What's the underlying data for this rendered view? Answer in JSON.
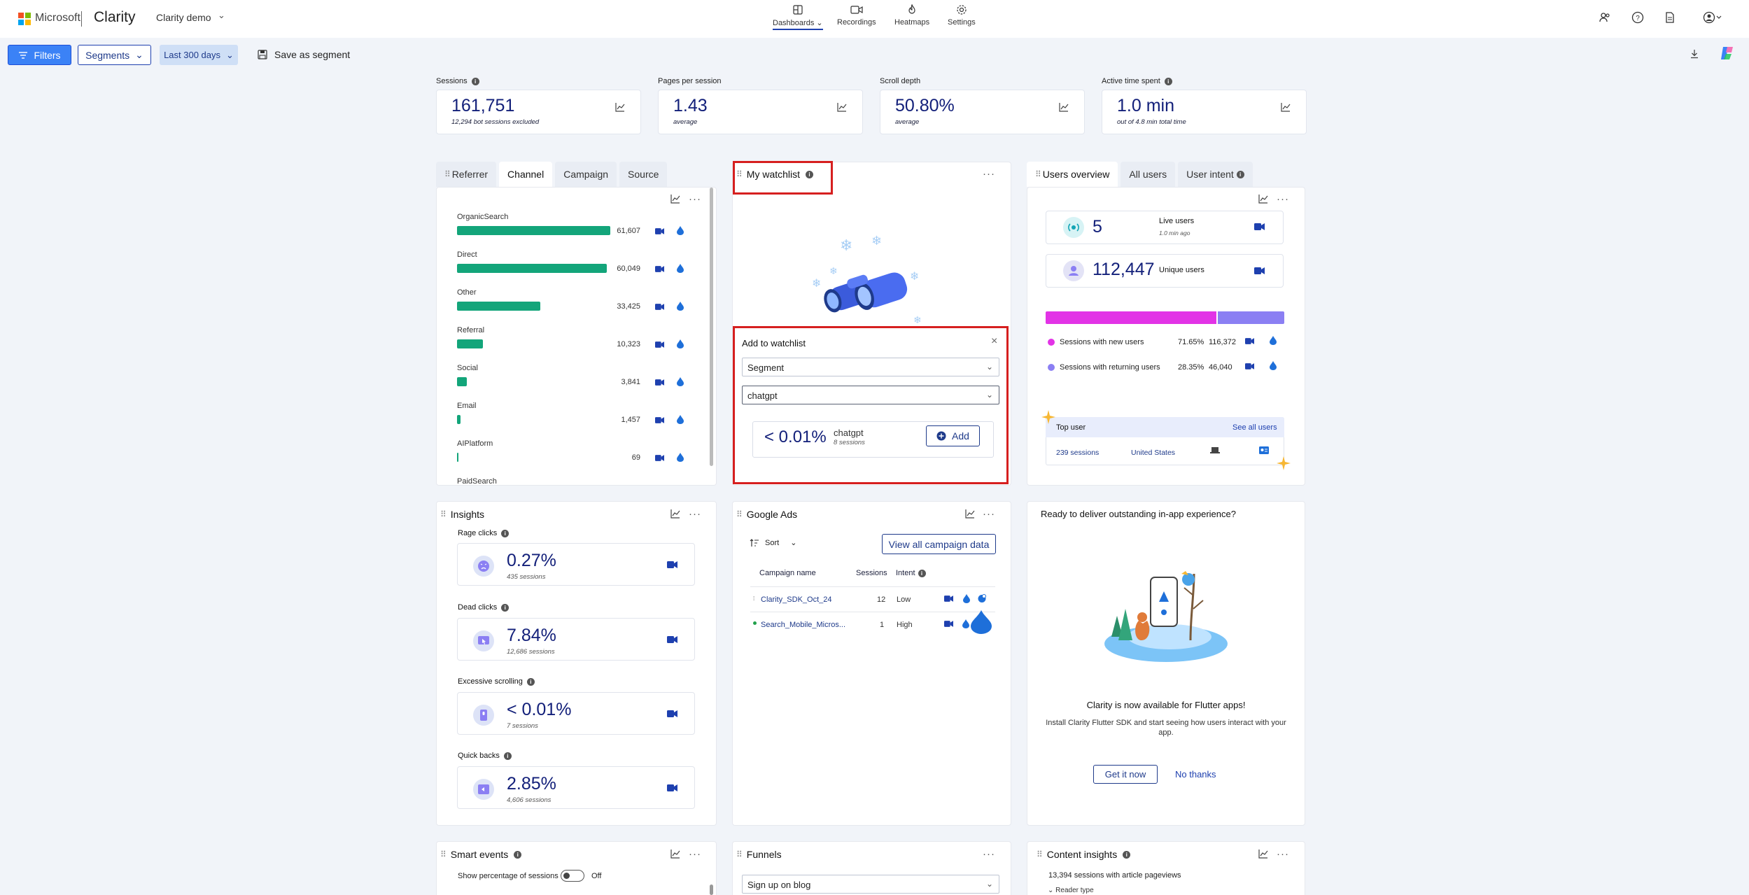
{
  "colors": {
    "accent": "#3b82f6",
    "brand_navy": "#13207a",
    "channel_bar": "#13a57a",
    "new_users": "#e233e6",
    "returning_users": "#8b7ff3",
    "highlight": "#d61f1f"
  },
  "topbar": {
    "ms_label": "Microsoft",
    "brand": "Clarity",
    "project": "Clarity demo",
    "nav": [
      {
        "label": "Dashboards",
        "icon": "dashboard-icon"
      },
      {
        "label": "Recordings",
        "icon": "video-icon"
      },
      {
        "label": "Heatmaps",
        "icon": "flame-icon"
      },
      {
        "label": "Settings",
        "icon": "gear-icon"
      }
    ]
  },
  "filterbar": {
    "filters": "Filters",
    "segments": "Segments",
    "date": "Last 300 days",
    "save": "Save as segment"
  },
  "metrics": [
    {
      "label": "Sessions",
      "value": "161,751",
      "sub": "12,294 bot sessions excluded"
    },
    {
      "label": "Pages per session",
      "value": "1.43",
      "sub": "average"
    },
    {
      "label": "Scroll depth",
      "value": "50.80%",
      "sub": "average"
    },
    {
      "label": "Active time spent",
      "value": "1.0 min",
      "sub": "out of 4.8 min total time"
    }
  ],
  "channel": {
    "tabs": [
      "Referrer",
      "Channel",
      "Campaign",
      "Source"
    ],
    "rows": [
      {
        "label": "OrganicSearch",
        "value": "61,607",
        "fraction": 1.0
      },
      {
        "label": "Direct",
        "value": "60,049",
        "fraction": 0.975
      },
      {
        "label": "Other",
        "value": "33,425",
        "fraction": 0.543
      },
      {
        "label": "Referral",
        "value": "10,323",
        "fraction": 0.168
      },
      {
        "label": "Social",
        "value": "3,841",
        "fraction": 0.062
      },
      {
        "label": "Email",
        "value": "1,457",
        "fraction": 0.024
      },
      {
        "label": "AIPlatform",
        "value": "69",
        "fraction": 0.0011
      }
    ],
    "cutoff_row": "PaidSearch"
  },
  "watchlist": {
    "title": "My watchlist",
    "add_title": "Add to watchlist",
    "type_select": "Segment",
    "segment_select": "chatgpt",
    "pct": "< 0.01%",
    "seg_name": "chatgpt",
    "seg_sessions": "8 sessions",
    "add": "Add"
  },
  "users": {
    "tabs": [
      "Users overview",
      "All users",
      "User intent"
    ],
    "live_value": "5",
    "live_label": "Live users",
    "live_sub": "1.0 min ago",
    "unique_value": "112,447",
    "unique_label": "Unique users",
    "new_fraction": 0.7165,
    "new_label": "Sessions with new users",
    "new_pct": "71.65%",
    "new_count": "116,372",
    "ret_label": "Sessions with returning users",
    "ret_pct": "28.35%",
    "ret_count": "46,040",
    "top_user_title": "Top user",
    "see_all": "See all users",
    "top_sessions": "239 sessions",
    "top_country": "United States"
  },
  "insights": {
    "title": "Insights",
    "items": [
      {
        "label": "Rage clicks",
        "value": "0.27%",
        "sub": "435 sessions"
      },
      {
        "label": "Dead clicks",
        "value": "7.84%",
        "sub": "12,686 sessions"
      },
      {
        "label": "Excessive scrolling",
        "value": "< 0.01%",
        "sub": "7 sessions"
      },
      {
        "label": "Quick backs",
        "value": "2.85%",
        "sub": "4,606 sessions"
      }
    ]
  },
  "ads": {
    "title": "Google Ads",
    "sort": "Sort",
    "view_all": "View all campaign data",
    "headers": [
      "Campaign name",
      "Sessions",
      "Intent"
    ],
    "rows": [
      {
        "name": "Clarity_SDK_Oct_24",
        "sessions": "12",
        "intent": "Low"
      },
      {
        "name": "Search_Mobile_Micros...",
        "sessions": "1",
        "intent": "High"
      }
    ]
  },
  "promo": {
    "title": "Ready to deliver outstanding in-app experience?",
    "heading": "Clarity is now available for Flutter apps!",
    "body": "Install Clarity Flutter SDK and start seeing how users interact with your app.",
    "primary": "Get it now",
    "secondary": "No thanks"
  },
  "smart": {
    "title": "Smart events",
    "toggle_label": "Show percentage of sessions",
    "toggle_state": "Off"
  },
  "funnels": {
    "title": "Funnels",
    "select": "Sign up on blog"
  },
  "content": {
    "title": "Content insights",
    "sub": "13,394 sessions with article pageviews",
    "reader": "Reader type"
  }
}
